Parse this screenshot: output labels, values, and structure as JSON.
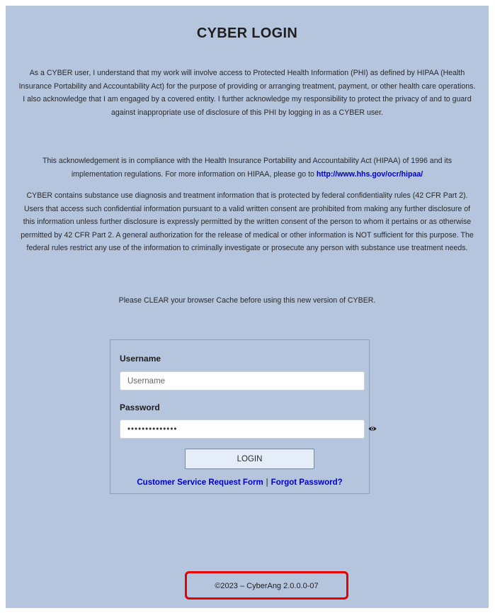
{
  "page": {
    "title": "CYBER LOGIN",
    "background_color": "#b4c5dd"
  },
  "notice": {
    "p1": "As a CYBER user, I understand that my work will involve access to Protected Health Information (PHI) as defined by HIPAA (Health Insurance Portability and Accountability Act) for the purpose of providing or arranging treatment, payment, or other health care operations. I also acknowledge that I am engaged by a covered entity. I further acknowledge my responsibility to protect the privacy of and to guard against inappropriate use of disclosure of this PHI by logging in as a CYBER user.",
    "p2_text": "This acknowledgement is in compliance with the Health Insurance Portability and Accountability Act (HIPAA) of 1996 and its implementation regulations. For more information on HIPAA, please go to",
    "p2_link": "http://www.hhs.gov/ocr/hipaa/",
    "p3": "CYBER contains substance use diagnosis and treatment information that is protected by federal confidentiality rules (42 CFR Part 2). Users that access such confidential information pursuant to a valid written consent are prohibited from making any further disclosure of this information unless further disclosure is expressly permitted by the written consent of the person to whom it pertains or as otherwise permitted by 42 CFR Part 2. A general authorization for the release of medical or other information is NOT sufficient for this purpose. The federal rules restrict any use of the information to criminally investigate or prosecute any person with substance use treatment needs.",
    "p4": "Please CLEAR your browser Cache before using this new version of CYBER."
  },
  "login": {
    "username_label": "Username",
    "username_placeholder": "Username",
    "username_value": "",
    "password_label": "Password",
    "password_value": "••••••••••••••",
    "password_toggle_icon": "eye-icon",
    "login_button": "LOGIN",
    "customer_service_link": "Customer Service Request Form",
    "separator": "|",
    "forgot_password_link": "Forgot Password?"
  },
  "footer": {
    "text": "©2023 – CyberAng 2.0.0.0-07",
    "highlight_color": "#e60000"
  }
}
